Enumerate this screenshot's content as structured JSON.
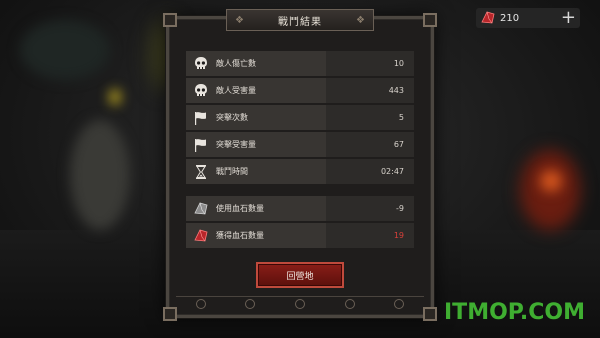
{
  "currency": {
    "amount": "210",
    "add_label": "+"
  },
  "panel": {
    "title": "戰鬥結果",
    "button_label": "回營地"
  },
  "stats": [
    {
      "icon": "skull-icon",
      "label": "敵人傷亡數",
      "value": "10"
    },
    {
      "icon": "skull-icon",
      "label": "敵人受害量",
      "value": "443"
    },
    {
      "icon": "white-flag-icon",
      "label": "突擊次數",
      "value": "5"
    },
    {
      "icon": "white-flag-icon",
      "label": "突擊受害量",
      "value": "67"
    },
    {
      "icon": "hourglass-icon",
      "label": "戰鬥時間",
      "value": "02:47"
    }
  ],
  "bloodstones": [
    {
      "icon": "grey-bloodstone-icon",
      "label": "使用血石數量",
      "value": "-9"
    },
    {
      "icon": "red-bloodstone-icon",
      "label": "獲得血石數量",
      "value": "19"
    }
  ],
  "watermark": "ITMOP.COM",
  "colors": {
    "accent_red": "#8a1e18",
    "negative_value": "#d8403a",
    "watermark_green": "#3fae31"
  }
}
